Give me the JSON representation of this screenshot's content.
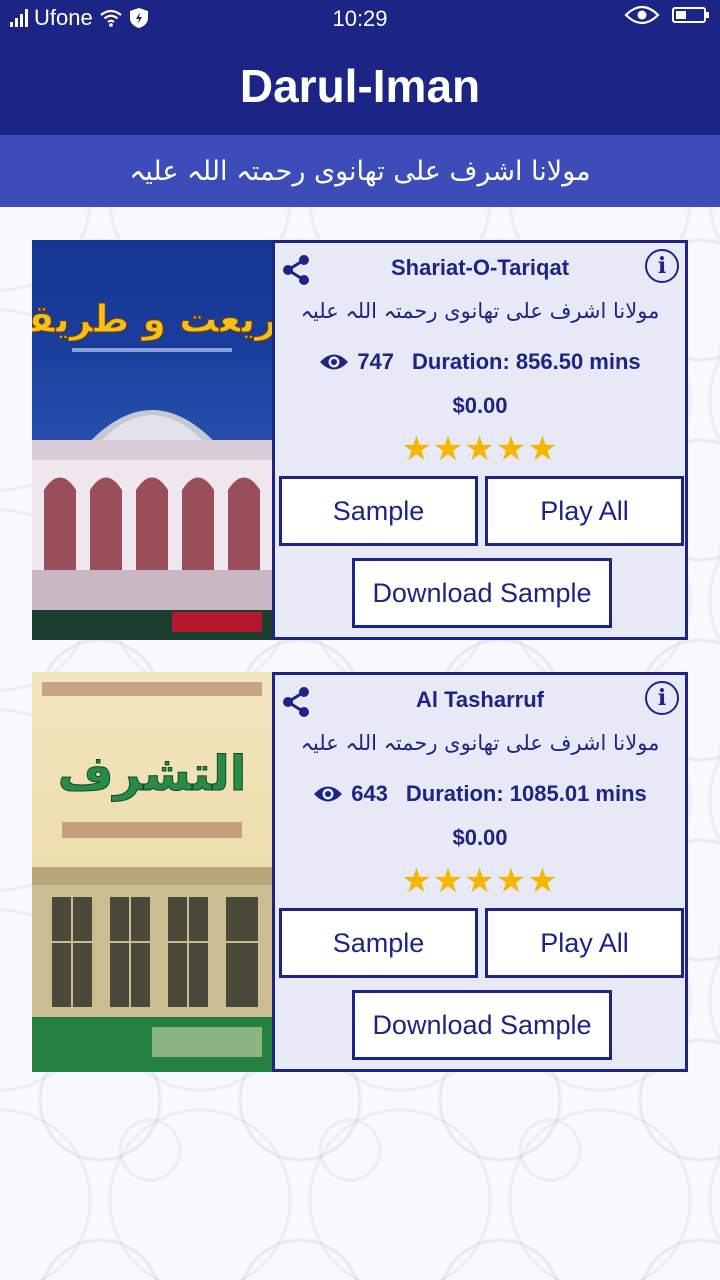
{
  "status_bar": {
    "carrier": "Ufone",
    "time": "10:29"
  },
  "app": {
    "title": "Darul-Iman",
    "subtitle": "مولانا اشرف علی تھانوی رحمتہ اللہ علیہ"
  },
  "books": [
    {
      "title": "Shariat-O-Tariqat",
      "author": "مولانا اشرف علی تھانوی رحمتہ اللہ علیہ",
      "views": "747",
      "duration": "Duration: 856.50 mins",
      "price": "$0.00",
      "rating": 5,
      "stars": "★★★★★",
      "sample_label": "Sample",
      "play_all_label": "Play All",
      "download_sample_label": "Download Sample",
      "cover_title": "شریعت و طریقت"
    },
    {
      "title": "Al Tasharruf",
      "author": "مولانا اشرف علی تھانوی رحمتہ اللہ علیہ",
      "views": "643",
      "duration": "Duration: 1085.01 mins",
      "price": "$0.00",
      "rating": 5,
      "stars": "★★★★★",
      "sample_label": "Sample",
      "play_all_label": "Play All",
      "download_sample_label": "Download Sample",
      "cover_title": "التشرف"
    }
  ],
  "colors": {
    "primary": "#1c2585",
    "secondary": "#3c4db9",
    "panel": "#e8e9f6",
    "star": "#f4b600"
  },
  "icons": [
    "signal-icon",
    "wifi-icon",
    "shield-icon",
    "eye-icon",
    "battery-icon",
    "share-icon",
    "info-icon"
  ]
}
